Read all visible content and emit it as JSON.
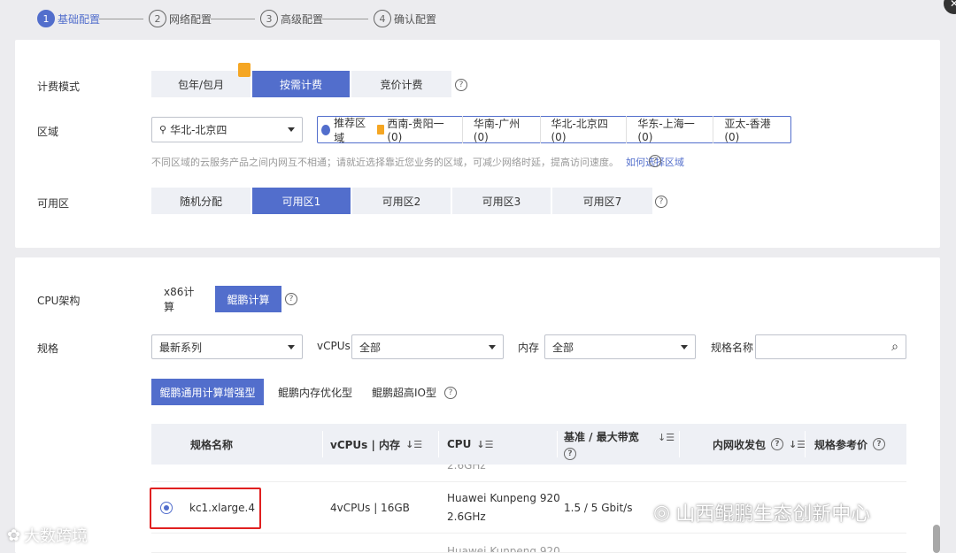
{
  "steps": [
    {
      "num": "1",
      "label": "基础配置",
      "active": true
    },
    {
      "num": "2",
      "label": "网络配置",
      "active": false
    },
    {
      "num": "3",
      "label": "高级配置",
      "active": false
    },
    {
      "num": "4",
      "label": "确认配置",
      "active": false
    }
  ],
  "billing": {
    "label": "计费模式",
    "options": [
      "包年/包月",
      "按需计费",
      "竞价计费"
    ],
    "selected": "按需计费"
  },
  "region": {
    "label": "区域",
    "selected": "华北-北京四",
    "recommend_label": "推荐区域",
    "recommend_items": [
      "西南-贵阳一 (0)",
      "华南-广州 (0)",
      "华北-北京四 (0)",
      "华东-上海一 (0)",
      "亚太-香港 (0)"
    ],
    "hint": "不同区域的云服务产品之间内网互不相通；请就近选择靠近您业务的区域，可减少网络时延，提高访问速度。",
    "hint_link": "如何选择区域"
  },
  "az": {
    "label": "可用区",
    "options": [
      "随机分配",
      "可用区1",
      "可用区2",
      "可用区3",
      "可用区7"
    ],
    "selected": "可用区1"
  },
  "cpu_arch": {
    "label": "CPU架构",
    "options": [
      "x86计算",
      "鲲鹏计算"
    ],
    "selected": "鲲鹏计算"
  },
  "spec": {
    "label": "规格",
    "series": "最新系列",
    "vcpus_label": "vCPUs",
    "vcpus_value": "全部",
    "mem_label": "内存",
    "mem_value": "全部",
    "name_label": "规格名称",
    "name_value": ""
  },
  "spec_tabs": {
    "options": [
      "鲲鹏通用计算增强型",
      "鲲鹏内存优化型",
      "鲲鹏超高IO型"
    ],
    "selected": "鲲鹏通用计算增强型"
  },
  "table": {
    "headers": {
      "name": "规格名称",
      "vcpu_mem": "vCPUs | 内存",
      "cpu": "CPU",
      "bandwidth": "基准 / 最大带宽",
      "pps": "内网收发包",
      "price": "规格参考价"
    },
    "partial_top": "2.6GHz",
    "row": {
      "name": "kc1.xlarge.4",
      "vcpu_mem": "4vCPUs | 16GB",
      "cpu_line1": "Huawei Kunpeng 920",
      "cpu_line2": "2.6GHz",
      "bandwidth": "1.5 / 5 Gbit/s"
    },
    "partial_bottom": "Huawei Kunpeng 920"
  },
  "watermarks": {
    "left": "大数跨境",
    "right": "山西鲲鹏生态创新中心"
  }
}
